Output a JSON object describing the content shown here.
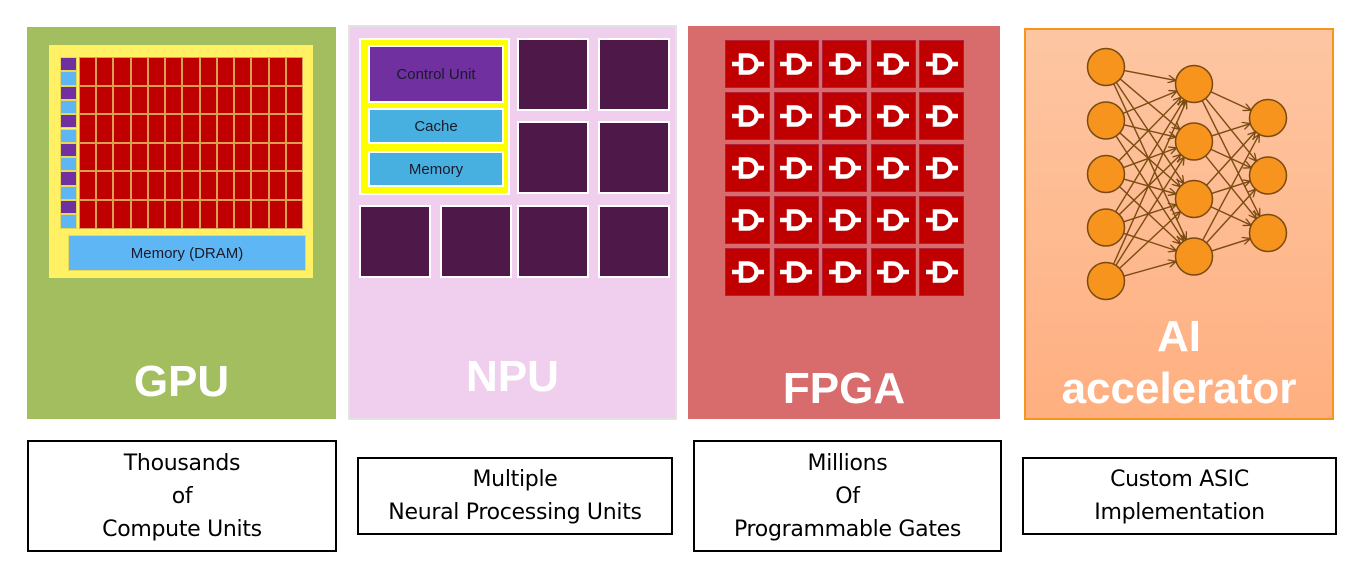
{
  "panels": {
    "gpu": {
      "title": "GPU",
      "memory_label": "Memory (DRAM)",
      "compute_rows": 6,
      "compute_cols": 13,
      "colors": {
        "background": "#A2BE5E",
        "chip": "#FFF064",
        "compute_unit": "#C00000",
        "control": "#7030A0",
        "cache": "#5FB6F5"
      }
    },
    "npu": {
      "title": "NPU",
      "control_unit_label": "Control Unit",
      "cache_label": "Cache",
      "memory_label": "Memory",
      "core_count": 8,
      "colors": {
        "background": "#F0CFEE",
        "cluster": "#FFFF00",
        "control": "#7030A0",
        "cache": "#47B0E0",
        "core": "#4E1848"
      }
    },
    "fpga": {
      "title": "FPGA",
      "gate_rows": 5,
      "gate_cols": 5,
      "gate_icon": "and-gate-icon",
      "colors": {
        "background": "#D86B6B",
        "gate": "#C00000"
      }
    },
    "ai": {
      "title_line1": "AI",
      "title_line2": "accelerator",
      "network_layers": [
        5,
        4,
        3
      ],
      "colors": {
        "background": "#FFBB91",
        "border": "#F7941D",
        "node": "#F7941D",
        "edge": "#7A4A10"
      }
    }
  },
  "captions": {
    "gpu": [
      "Thousands",
      "of",
      "Compute Units"
    ],
    "npu": [
      "Multiple",
      "Neural Processing Units"
    ],
    "fpga": [
      "Millions",
      "Of",
      "Programmable Gates"
    ],
    "ai": [
      "Custom ASIC",
      "Implementation"
    ]
  }
}
